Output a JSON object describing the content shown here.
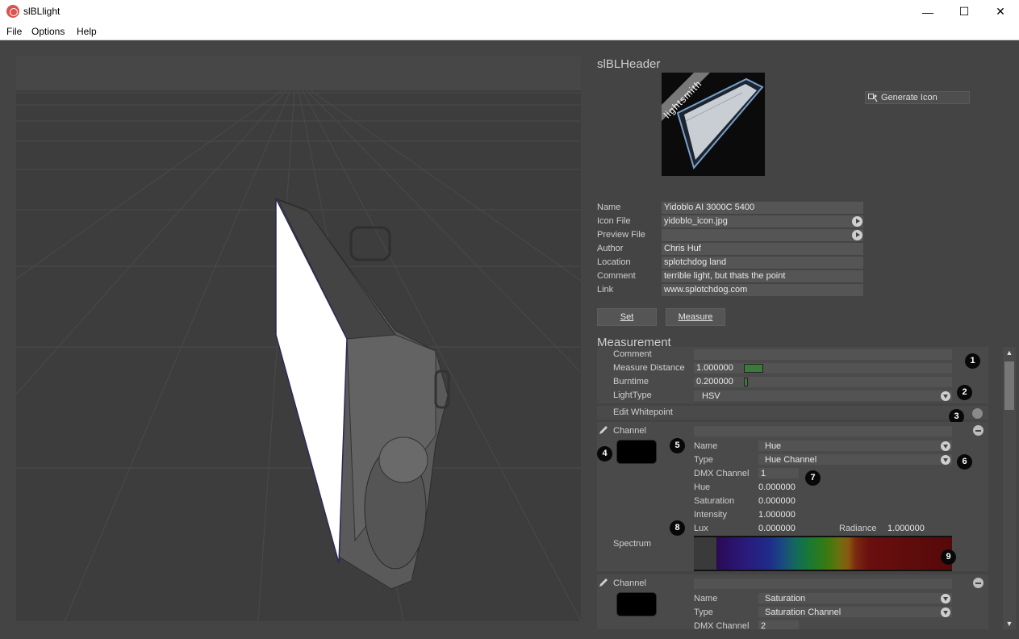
{
  "window": {
    "title": "slBLlight",
    "minimize": "—",
    "maximize": "☐",
    "close": "✕"
  },
  "menu": [
    "File",
    "Options",
    "Help"
  ],
  "header": {
    "title": "slBLHeader",
    "generate_icon_label": "Generate Icon",
    "preview_watermark": "lightsmith",
    "fields": [
      {
        "label": "Name",
        "value": "Yidoblo AI 3000C 5400"
      },
      {
        "label": "Icon File",
        "value": "yidoblo_icon.jpg"
      },
      {
        "label": "Preview File",
        "value": ""
      },
      {
        "label": "Author",
        "value": "Chris Huf"
      },
      {
        "label": "Location",
        "value": "splotchdog land"
      },
      {
        "label": "Comment",
        "value": "terrible light, but thats the point"
      },
      {
        "label": "Link",
        "value": "www.splotchdog.com"
      }
    ],
    "set_label": "Set",
    "measure_label": "Measure"
  },
  "measurement": {
    "title": "Measurement",
    "comment_label": "Comment",
    "comment_value": "",
    "measure_distance_label": "Measure Distance",
    "measure_distance_value": "1.000000",
    "burntime_label": "Burntime",
    "burntime_value": "0.200000",
    "lighttype_label": "LightType",
    "lighttype_value": "HSV",
    "edit_whitepoint_label": "Edit Whitepoint"
  },
  "channels": [
    {
      "header": "Channel",
      "swatch_color": "#000000",
      "name_label": "Name",
      "name_value": "Hue",
      "type_label": "Type",
      "type_value": "Hue Channel",
      "dmx_label": "DMX Channel",
      "dmx_value": "1",
      "hue_label": "Hue",
      "hue_value": "0.000000",
      "saturation_label": "Saturation",
      "saturation_value": "0.000000",
      "intensity_label": "Intensity",
      "intensity_value": "1.000000",
      "lux_label": "Lux",
      "lux_value": "0.000000",
      "radiance_label": "Radiance",
      "radiance_value": "1.000000",
      "spectrum_label": "Spectrum"
    },
    {
      "header": "Channel",
      "swatch_color": "#000000",
      "name_label": "Name",
      "name_value": "Saturation",
      "type_label": "Type",
      "type_value": "Saturation Channel",
      "dmx_label": "DMX Channel",
      "dmx_value": "2"
    }
  ],
  "badges": [
    "1",
    "2",
    "3",
    "4",
    "5",
    "6",
    "7",
    "8",
    "9"
  ],
  "scrollbar": {
    "up": "▲",
    "down": "▼"
  },
  "colors": {
    "background": "#444444",
    "field": "#555555",
    "accent_bar": "#3a7a3a",
    "badge": "#080808"
  }
}
